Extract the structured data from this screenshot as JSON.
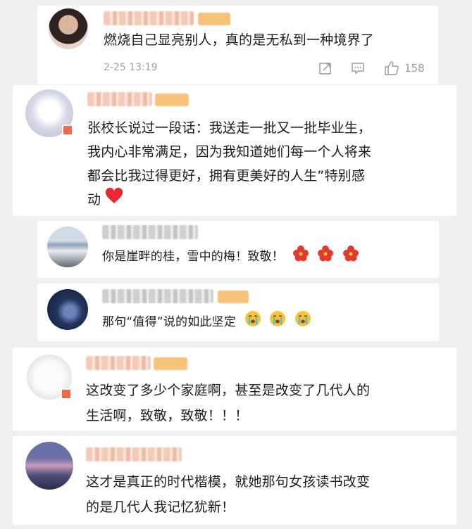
{
  "comments": [
    {
      "text": "燃烧自己显亮别人，真的是无私到一种境界了",
      "time": "2-25 13:19",
      "likes": "158"
    },
    {
      "text_lines": [
        "张校长说过一段话：我送走一批又一批毕业生，",
        "我内心非常满足，因为我知道她们每一个人将来",
        "都会比我过得更好，拥有更美好的人生”特别感",
        "动"
      ]
    },
    {
      "text": "你是崖畔的桂，雪中的梅！致敬！"
    },
    {
      "text": "那句“值得”说的如此坚定"
    },
    {
      "text_lines": [
        "这改变了多少个家庭啊，甚至是改变了几代人的",
        "生活啊，致敬，致敬！！！"
      ]
    },
    {
      "text_lines": [
        "这才是真正的时代楷模，就她那句女孩读书改变",
        "的是几代人我记忆犹新！"
      ]
    }
  ],
  "icons": {
    "share": "share-icon",
    "comment": "comment-icon",
    "like": "thumbs-up-icon",
    "heart": "red-heart-emoji",
    "flower": "red-flower-emoji",
    "cry": "crying-face-emoji"
  },
  "colors": {
    "background": "#f0f0f2",
    "meta": "#a3a3a3",
    "badge": "#ec6a4a",
    "heart": "#e8292f"
  }
}
